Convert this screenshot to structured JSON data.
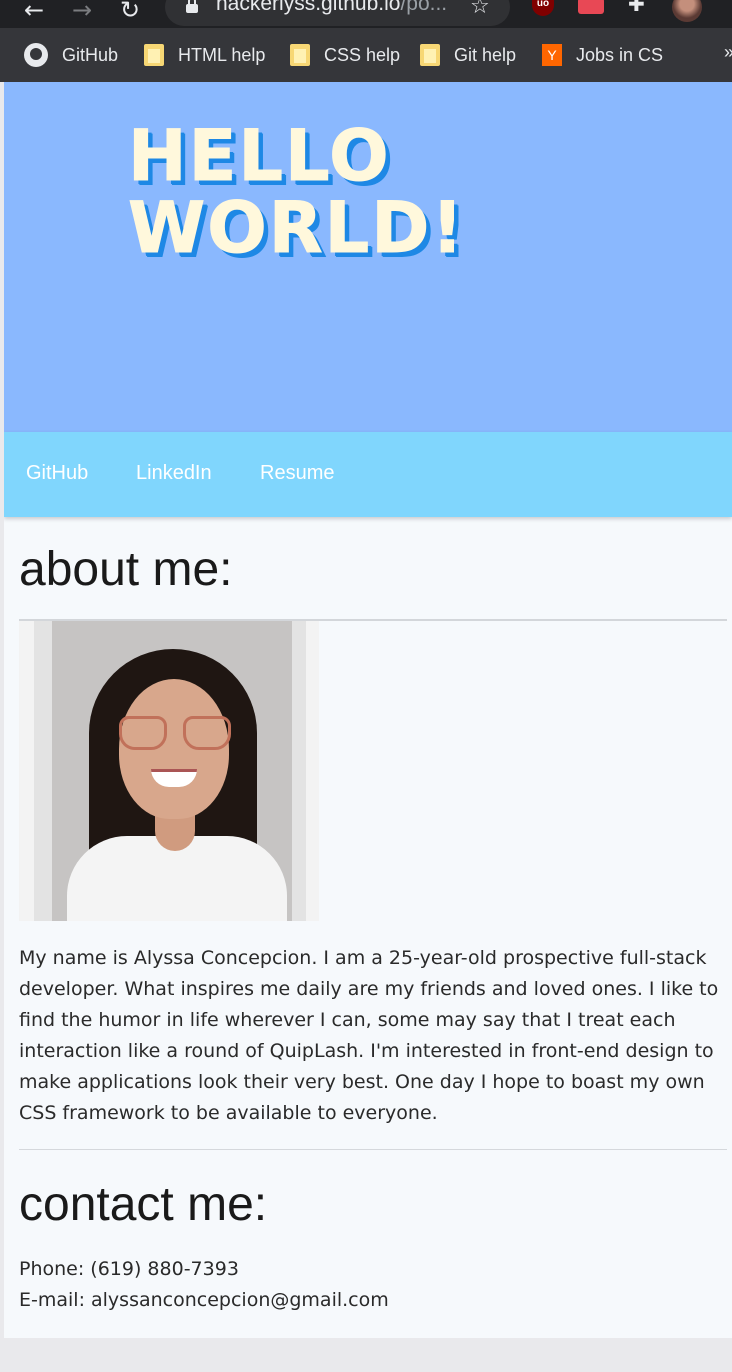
{
  "browser": {
    "url_host": "hackerlyss.github.io",
    "url_path": "/po...",
    "bookmarks": [
      {
        "label": "GitHub",
        "icon": "github-icon"
      },
      {
        "label": "HTML help",
        "icon": "folder-icon"
      },
      {
        "label": "CSS help",
        "icon": "folder-icon"
      },
      {
        "label": "Git help",
        "icon": "folder-icon"
      },
      {
        "label": "Jobs in CS",
        "icon": "y-icon"
      }
    ],
    "more": "»"
  },
  "hero": {
    "line1": "HELLO",
    "line2": "WORLD!"
  },
  "nav": {
    "github": "GitHub",
    "linkedin": "LinkedIn",
    "resume": "Resume"
  },
  "about": {
    "heading": "about me:",
    "bio": "My name is Alyssa Concepcion. I am a 25-year-old prospective full-stack developer. What inspires me daily are my friends and loved ones. I like to find the humor in life wherever I can, some may say that I treat each interaction like a round of QuipLash. I'm interested in front-end design to make applications look their very best. One day I hope to boast my own CSS framework to be available to everyone."
  },
  "contact": {
    "heading": "contact me:",
    "phone": "Phone: (619) 880-7393",
    "email": "E-mail: alyssanconcepcion@gmail.com"
  },
  "colors": {
    "hero_bg": "#8ab8fe",
    "nav_bg": "#80d6fd",
    "title_fill": "#fff8dc",
    "title_shadow": "#1e88e5",
    "page_bg": "#f6f9fc"
  }
}
